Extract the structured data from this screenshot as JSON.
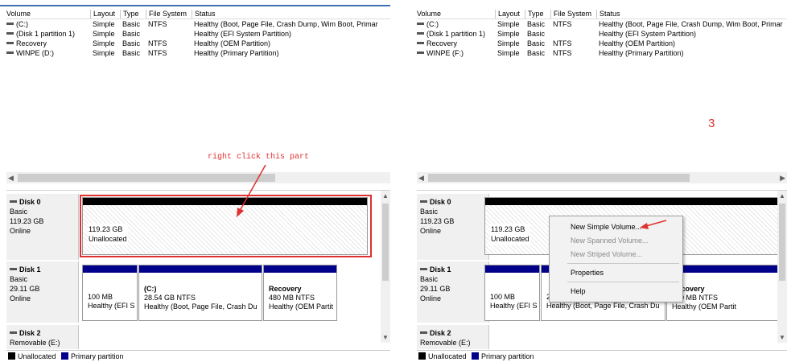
{
  "columns": [
    "Volume",
    "Layout",
    "Type",
    "File System",
    "Status"
  ],
  "volumes": [
    {
      "volume": "(C:)",
      "layout": "Simple",
      "type": "Basic",
      "fs": "NTFS",
      "status": "Healthy (Boot, Page File, Crash Dump, Wim Boot, Primar"
    },
    {
      "volume": "(Disk 1 partition 1)",
      "layout": "Simple",
      "type": "Basic",
      "fs": "",
      "status": "Healthy (EFI System Partition)"
    },
    {
      "volume": "Recovery",
      "layout": "Simple",
      "type": "Basic",
      "fs": "NTFS",
      "status": "Healthy (OEM Partition)"
    },
    {
      "volume": "WINPE (D:)",
      "layout": "Simple",
      "type": "Basic",
      "fs": "NTFS",
      "status": "Healthy (Primary Partition)"
    }
  ],
  "volumes_right": [
    {
      "volume": "(C:)",
      "layout": "Simple",
      "type": "Basic",
      "fs": "NTFS",
      "status": "Healthy (Boot, Page File, Crash Dump, Wim Boot, Primar"
    },
    {
      "volume": "(Disk 1 partition 1)",
      "layout": "Simple",
      "type": "Basic",
      "fs": "",
      "status": "Healthy (EFI System Partition)"
    },
    {
      "volume": "Recovery",
      "layout": "Simple",
      "type": "Basic",
      "fs": "NTFS",
      "status": "Healthy (OEM Partition)"
    },
    {
      "volume": "WINPE (F:)",
      "layout": "Simple",
      "type": "Basic",
      "fs": "NTFS",
      "status": "Healthy (Primary Partition)"
    }
  ],
  "disk0": {
    "name": "Disk 0",
    "type": "Basic",
    "size": "119.23 GB",
    "state": "Online",
    "unalloc_size": "119.23 GB",
    "unalloc_label": "Unallocated"
  },
  "disk1": {
    "name": "Disk 1",
    "type": "Basic",
    "size": "29.11 GB",
    "state": "Online",
    "p1": {
      "size": "100 MB",
      "status": "Healthy (EFI S"
    },
    "p2": {
      "name": "(C:)",
      "size": "28.54 GB NTFS",
      "status": "Healthy (Boot, Page File, Crash Du"
    },
    "p3": {
      "name": "Recovery",
      "size": "480 MB NTFS",
      "status": "Healthy (OEM Partit"
    },
    "p2_right_size": "2",
    "p3_right": {
      "name": "covery",
      "size": "MB NTFS",
      "prefix": ")",
      "status": "Healthy (OEM Partit"
    }
  },
  "disk2": {
    "name": "Disk 2",
    "type_left": "Removable (E:)",
    "type_right": "Removable (E:)"
  },
  "legend": {
    "unallocated": "Unallocated",
    "primary": "Primary partition",
    "unalloc_color": "#000000",
    "primary_color": "#00008a"
  },
  "annotation": {
    "text": "right click this part",
    "step": "3",
    "color": "#e03030"
  },
  "context_menu": {
    "items": [
      "New Simple Volume...",
      "New Spanned Volume...",
      "New Striped Volume...",
      "Properties",
      "Help"
    ]
  }
}
